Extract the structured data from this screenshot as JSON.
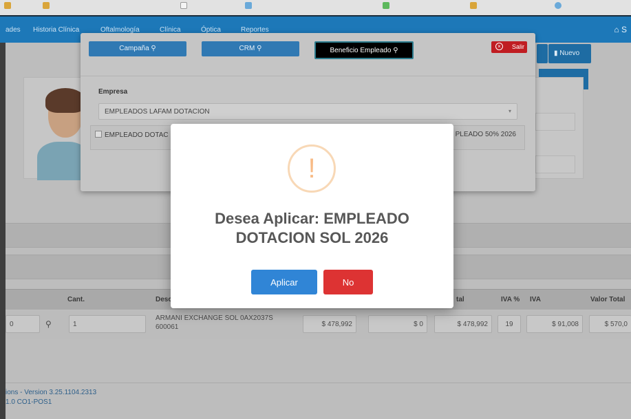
{
  "navbar": {
    "items": [
      "ades",
      "Historia Clínica",
      "Oftalmología",
      "Clínica",
      "Óptica",
      "Reportes"
    ],
    "home_label": "S"
  },
  "toolbar": {
    "nuevo_label": "Nuevo"
  },
  "table": {
    "headers": {
      "cant": "Cant.",
      "desc": "Desc",
      "total_partial": "tal",
      "iva_pct": "IVA %",
      "iva": "IVA",
      "valor_total": "Valor Total"
    },
    "row": {
      "code_partial": "0",
      "cant": "1",
      "description": "ARMANI EXCHANGE SOL 0AX2037S 600061",
      "price": "$ 478,992",
      "discount": "$ 0",
      "subtotal": "$ 478,992",
      "iva_pct": "19",
      "iva": "$ 91,008",
      "total_partial": "$ 570,0"
    }
  },
  "footer": {
    "version": "ions - Version 3.25.1104.2313",
    "sub": "1.0 CO1-POS1"
  },
  "bg_modal": {
    "tabs": [
      "Campaña",
      "CRM",
      "Beneficio Empleado"
    ],
    "close_label": "Salir",
    "empresa_label": "Empresa",
    "empresa_value": "EMPLEADOS LAFAM DOTACION",
    "img_left": "EMPLEADO DOTAC",
    "img_right": "PLEADO 50% 2026"
  },
  "alert": {
    "icon": "!",
    "title": "Desea Aplicar: EMPLEADO DOTACION SOL 2026",
    "confirm_label": "Aplicar",
    "cancel_label": "No"
  }
}
